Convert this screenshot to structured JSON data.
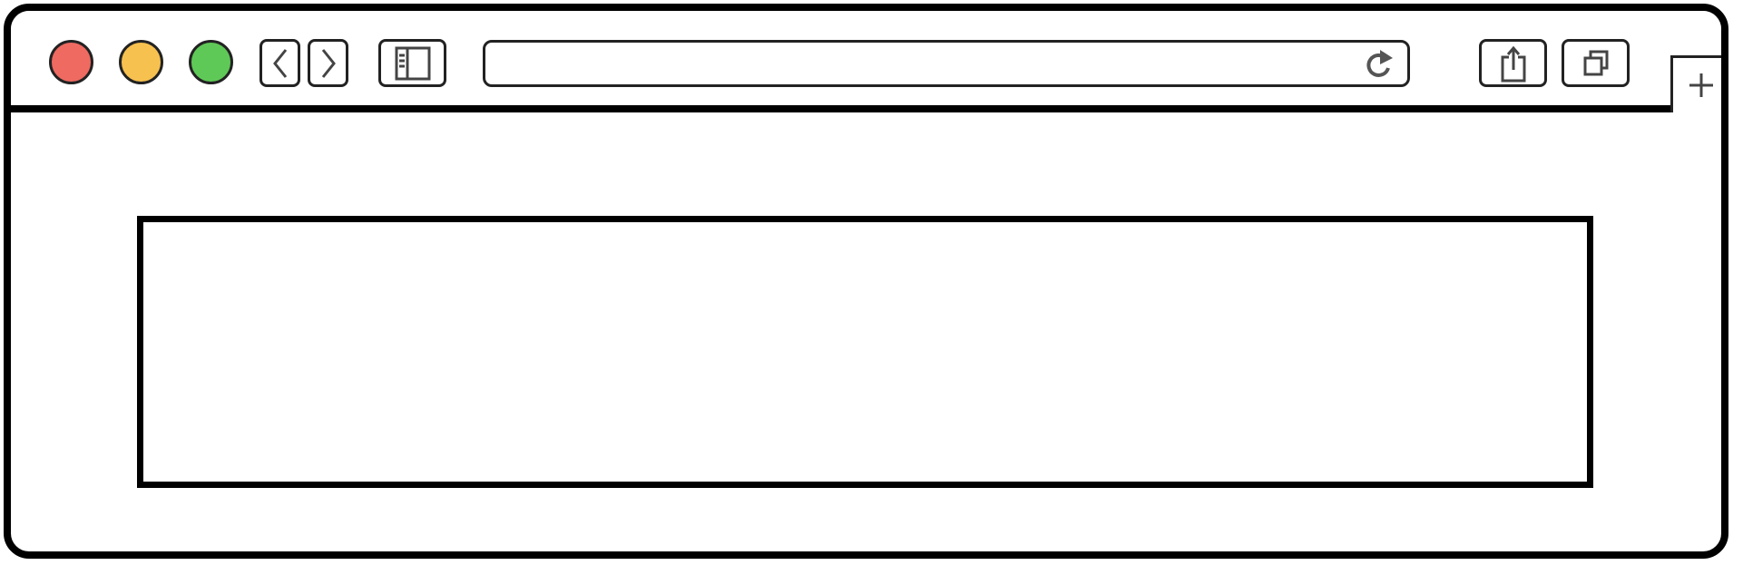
{
  "window": {
    "traffic_colors": {
      "close": "#ef6a61",
      "minimize": "#f7c14f",
      "zoom": "#5fc957"
    }
  },
  "toolbar": {
    "icons": {
      "back": "chevron-left-icon",
      "forward": "chevron-right-icon",
      "sidebar": "sidebar-icon",
      "reload": "reload-icon",
      "share": "share-icon",
      "tabs": "tabs-overview-icon",
      "new_tab": "plus-icon"
    }
  },
  "addressbar": {
    "value": ""
  },
  "content": {
    "box_text": ""
  }
}
